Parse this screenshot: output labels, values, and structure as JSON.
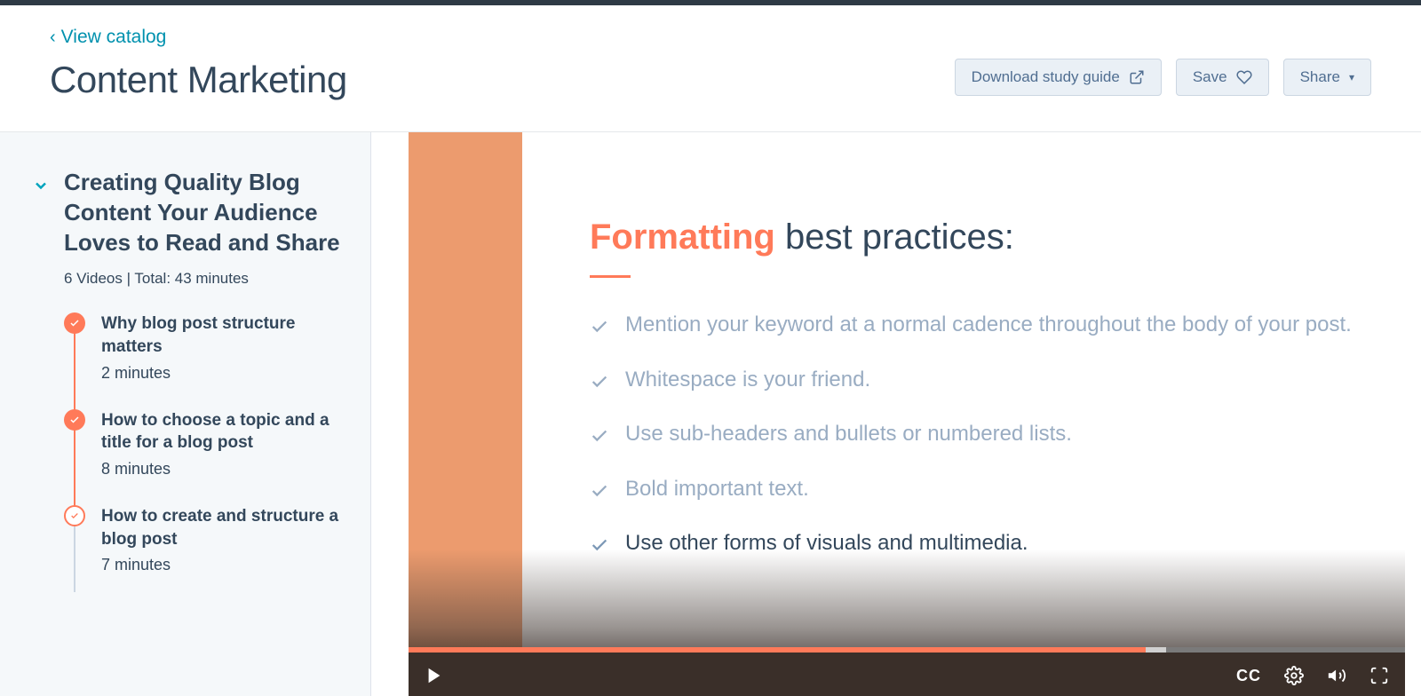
{
  "nav": {
    "back_label": "View catalog",
    "page_title": "Content Marketing"
  },
  "actions": {
    "download": "Download study guide",
    "save": "Save",
    "share": "Share"
  },
  "section": {
    "title": "Creating Quality Blog Content Your Audi­ence Loves to Read and Share",
    "meta": "6 Videos | Total: 43 minutes"
  },
  "lessons": [
    {
      "title": "Why blog post structure matters",
      "duration": "2 minutes",
      "status": "done"
    },
    {
      "title": "How to choose a topic and a title for a blog post",
      "duration": "8 minutes",
      "status": "done"
    },
    {
      "title": "How to create and structure a blog post",
      "duration": "7 minutes",
      "status": "current"
    }
  ],
  "slide": {
    "heading_accent": "Formatting",
    "heading_rest": " best practices:",
    "bullets": [
      {
        "text": "Mention your keyword at a normal cadence throughout the body of your post.",
        "active": false
      },
      {
        "text": "Whitespace is your friend.",
        "active": false
      },
      {
        "text": "Use sub-headers and bullets or numbered lists.",
        "active": false
      },
      {
        "text": "Bold important text.",
        "active": false
      },
      {
        "text": "Use other forms of visuals and multimedia.",
        "active": true
      }
    ]
  },
  "player": {
    "cc": "CC"
  }
}
